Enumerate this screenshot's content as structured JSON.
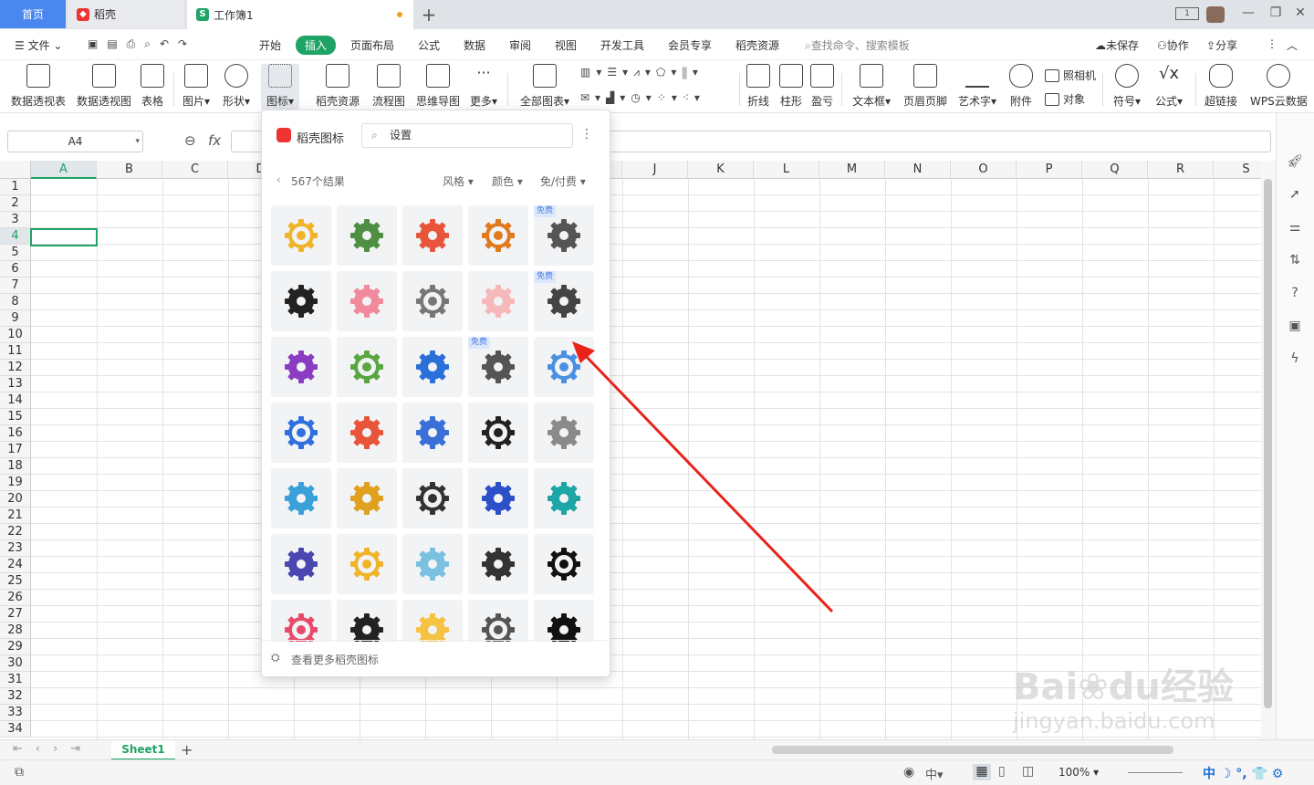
{
  "tabs": {
    "home": "首页",
    "daoke": "稻壳",
    "workbook": "工作簿1"
  },
  "menu": {
    "file": "文件",
    "items": [
      "开始",
      "插入",
      "页面布局",
      "公式",
      "数据",
      "审阅",
      "视图",
      "开发工具",
      "会员专享",
      "稻壳资源"
    ],
    "search": "查找命令、搜索模板",
    "unsaved": "未保存",
    "collab": "协作",
    "share": "分享"
  },
  "ribbon": {
    "big": [
      "数据透视表",
      "数据透视图",
      "表格",
      "图片",
      "形状",
      "图标",
      "稻壳资源",
      "流程图",
      "思维导图",
      "更多",
      "全部图表",
      "折线",
      "柱形",
      "盈亏",
      "文本框",
      "页眉页脚",
      "艺术字",
      "附件",
      "符号",
      "公式",
      "超链接",
      "WPS云数据"
    ],
    "small": [
      "照相机",
      "对象"
    ]
  },
  "formula": {
    "namebox": "A4",
    "fx": "fx"
  },
  "columns": [
    "A",
    "B",
    "C",
    "D",
    "E",
    "F",
    "G",
    "H",
    "I",
    "J",
    "K",
    "L",
    "M",
    "N",
    "O",
    "P",
    "Q",
    "R",
    "S"
  ],
  "rows": [
    "1",
    "2",
    "3",
    "4",
    "5",
    "6",
    "7",
    "8",
    "9",
    "10",
    "11",
    "12",
    "13",
    "14",
    "15",
    "16",
    "17",
    "18",
    "19",
    "20",
    "21",
    "22",
    "23",
    "24",
    "25",
    "26",
    "27",
    "28",
    "29",
    "30",
    "31",
    "32",
    "33",
    "34"
  ],
  "selected_cell": "A4",
  "sheet": {
    "tab": "Sheet1"
  },
  "status": {
    "zoom": "100%"
  },
  "popup": {
    "title": "稻壳图标",
    "search_value": "设置",
    "result_count": "567个结果",
    "filters": [
      "风格",
      "颜色",
      "免/付费"
    ],
    "free_badge": "免费",
    "footer": "查看更多稻壳图标",
    "icons": [
      [
        "gear-yellow-circle-icon",
        "gears-map-person-icon",
        "gears-colorful-icon",
        "gear-orange-icon",
        "gears-dark-free-icon"
      ],
      [
        "gears-black-icon",
        "gear-pink-icon",
        "gear-gray-circle-icon",
        "gear-pink-outline-icon",
        "gear-dark-free-icon"
      ],
      [
        "gears-purple-icon",
        "gear-green-magnifier-icon",
        "gear-blue-dot-icon",
        "gears-dark-small-free-icon",
        "gear-blue-selected-icon"
      ],
      [
        "gear-blue-icon",
        "gear-chat-icon",
        "gears-blue-small-icon",
        "gear-outline-black-icon",
        "gear-gray-icon"
      ],
      [
        "settings-window-icon",
        "gear-yellow-outline-icon",
        "gear-outline-thick-icon",
        "wrench-circle-icon",
        "gear-teal-circle-icon"
      ],
      [
        "hexagon-gear-icon",
        "gears-blue-yellow-icon",
        "gear-lightblue-outline-icon",
        "gear-outline-dark-icon",
        "gear-black-solid-icon"
      ],
      [
        "gear-red-outline-icon",
        "gear-black-outline-icon",
        "gear-yellow-solid-icon",
        "gear-person-icon",
        "gear-black-bold-icon"
      ]
    ],
    "free_icons": [
      [
        0,
        4
      ],
      [
        1,
        4
      ],
      [
        2,
        3
      ]
    ]
  },
  "colors": {
    "accent": "#1fa366",
    "tab_home": "#4a88f0",
    "arrow": "#e8231a"
  }
}
